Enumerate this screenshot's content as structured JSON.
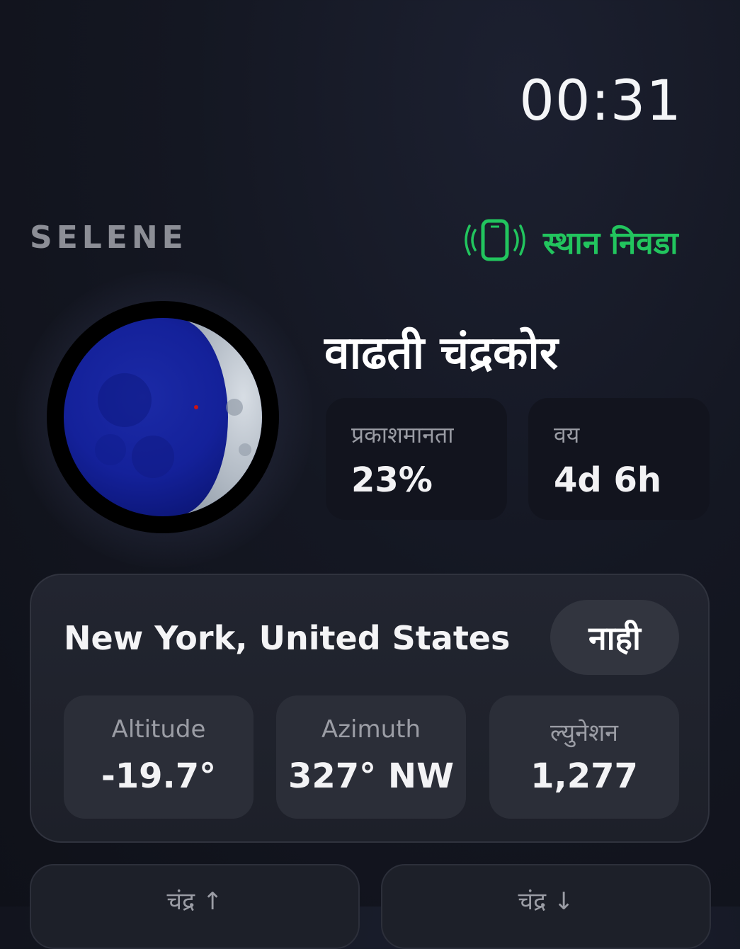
{
  "clock": "00:31",
  "brand": "SELENE",
  "location_button": {
    "label": "स्थान निवडा",
    "icon": "phone-signal-icon"
  },
  "phase": {
    "name": "वाढती चंद्रकोर",
    "illumination_label": "प्रकाशमानता",
    "illumination_value": "23%",
    "age_label": "वय",
    "age_value": "4d 6h"
  },
  "location_panel": {
    "city": "New York, United States",
    "toggle_label": "नाही",
    "metrics": [
      {
        "label": "Altitude",
        "value": "-19.7°"
      },
      {
        "label": "Azimuth",
        "value": "327° NW"
      },
      {
        "label": "ल्युनेशन",
        "value": "1,277"
      }
    ]
  },
  "bottom": {
    "moonrise_label": "चंद्र ↑",
    "moonset_label": "चंद्र ↓"
  },
  "colors": {
    "accent": "#22c55e",
    "moon_dark": "#0f1d8a",
    "moon_lit": "#b9c2cc"
  }
}
